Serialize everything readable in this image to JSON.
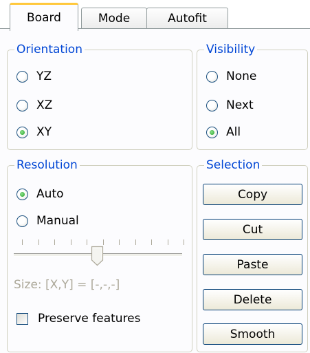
{
  "tabs": [
    {
      "label": "Board"
    },
    {
      "label": "Mode"
    },
    {
      "label": "Autofit"
    }
  ],
  "orientation": {
    "title": "Orientation",
    "options": [
      {
        "label": "YZ",
        "checked": false
      },
      {
        "label": "XZ",
        "checked": false
      },
      {
        "label": "XY",
        "checked": true
      }
    ]
  },
  "visibility": {
    "title": "Visibility",
    "options": [
      {
        "label": "None",
        "checked": false
      },
      {
        "label": "Next",
        "checked": false
      },
      {
        "label": "All",
        "checked": true
      }
    ]
  },
  "resolution": {
    "title": "Resolution",
    "options": [
      {
        "label": "Auto",
        "checked": true
      },
      {
        "label": "Manual",
        "checked": false
      }
    ],
    "slider_position": 0.5,
    "size_label": "Size: [X,Y] = [-,-,-]",
    "preserve_label": "Preserve features",
    "preserve_checked": false
  },
  "selection": {
    "title": "Selection",
    "buttons": [
      "Copy",
      "Cut",
      "Paste",
      "Delete",
      "Smooth"
    ]
  }
}
